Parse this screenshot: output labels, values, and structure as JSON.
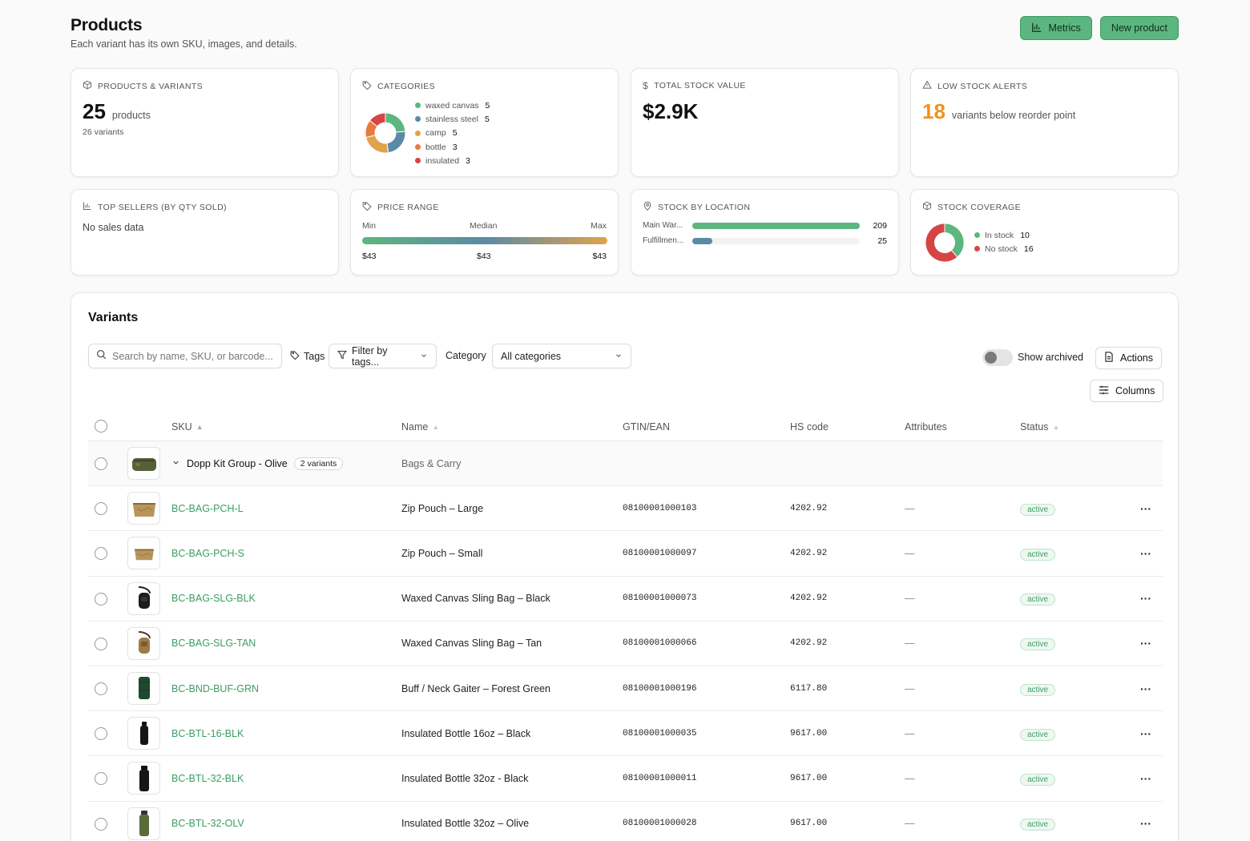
{
  "header": {
    "title": "Products",
    "subtitle": "Each variant has its own SKU, images, and details.",
    "metrics_label": "Metrics",
    "new_product_label": "New product"
  },
  "cards": {
    "products_variants": {
      "title": "PRODUCTS & VARIANTS",
      "count": "25",
      "count_unit": "products",
      "variants_text": "26 variants"
    },
    "categories": {
      "title": "CATEGORIES",
      "items": [
        {
          "label": "waxed canvas",
          "count": "5",
          "color": "#5cb67f"
        },
        {
          "label": "stainless steel",
          "count": "5",
          "color": "#5b8aa6"
        },
        {
          "label": "camp",
          "count": "5",
          "color": "#e0a24a"
        },
        {
          "label": "bottle",
          "count": "3",
          "color": "#e87a3c"
        },
        {
          "label": "insulated",
          "count": "3",
          "color": "#d64545"
        }
      ]
    },
    "total_stock_value": {
      "title": "TOTAL STOCK VALUE",
      "value": "$2.9K"
    },
    "low_stock": {
      "title": "LOW STOCK ALERTS",
      "value": "18",
      "text": "variants below reorder point",
      "color": "#f0921e"
    },
    "top_sellers": {
      "title": "TOP SELLERS (BY QTY SOLD)",
      "text": "No sales data"
    },
    "price_range": {
      "title": "PRICE RANGE",
      "min_label": "Min",
      "median_label": "Median",
      "max_label": "Max",
      "min": "$43",
      "median": "$43",
      "max": "$43"
    },
    "stock_by_location": {
      "title": "STOCK BY LOCATION",
      "locations": [
        {
          "label": "Main War...",
          "value": "209",
          "fraction": 1.0,
          "color": "#5cb67f"
        },
        {
          "label": "Fulfillmen...",
          "value": "25",
          "fraction": 0.12,
          "color": "#5b8aa6"
        }
      ]
    },
    "stock_coverage": {
      "title": "STOCK COVERAGE",
      "items": [
        {
          "label": "In stock",
          "count": "10",
          "color": "#5cb67f"
        },
        {
          "label": "No stock",
          "count": "16",
          "color": "#d64545"
        }
      ]
    }
  },
  "variants": {
    "title": "Variants",
    "search_placeholder": "Search by name, SKU, or barcode...",
    "tags_label": "Tags",
    "tags_filter": "Filter by tags...",
    "category_label": "Category",
    "category_value": "All categories",
    "show_archived": "Show archived",
    "actions_label": "Actions",
    "columns_label": "Columns",
    "headers": {
      "sku": "SKU",
      "name": "Name",
      "gtin": "GTIN/EAN",
      "hs": "HS code",
      "attributes": "Attributes",
      "status": "Status"
    },
    "group": {
      "name": "Dopp Kit Group - Olive",
      "variants_badge": "2 variants",
      "category": "Bags & Carry"
    },
    "rows": [
      {
        "sku": "BC-BAG-PCH-L",
        "name": "Zip Pouch – Large",
        "gtin": "08100001000103",
        "hs": "4202.92",
        "attributes": "—",
        "status": "active"
      },
      {
        "sku": "BC-BAG-PCH-S",
        "name": "Zip Pouch – Small",
        "gtin": "08100001000097",
        "hs": "4202.92",
        "attributes": "—",
        "status": "active"
      },
      {
        "sku": "BC-BAG-SLG-BLK",
        "name": "Waxed Canvas Sling Bag – Black",
        "gtin": "08100001000073",
        "hs": "4202.92",
        "attributes": "—",
        "status": "active"
      },
      {
        "sku": "BC-BAG-SLG-TAN",
        "name": "Waxed Canvas Sling Bag – Tan",
        "gtin": "08100001000066",
        "hs": "4202.92",
        "attributes": "—",
        "status": "active"
      },
      {
        "sku": "BC-BND-BUF-GRN",
        "name": "Buff / Neck Gaiter – Forest Green",
        "gtin": "08100001000196",
        "hs": "6117.80",
        "attributes": "—",
        "status": "active"
      },
      {
        "sku": "BC-BTL-16-BLK",
        "name": "Insulated Bottle 16oz – Black",
        "gtin": "08100001000035",
        "hs": "9617.00",
        "attributes": "—",
        "status": "active"
      },
      {
        "sku": "BC-BTL-32-BLK",
        "name": "Insulated Bottle 32oz - Black",
        "gtin": "08100001000011",
        "hs": "9617.00",
        "attributes": "—",
        "status": "active"
      },
      {
        "sku": "BC-BTL-32-OLV",
        "name": "Insulated Bottle 32oz – Olive",
        "gtin": "08100001000028",
        "hs": "9617.00",
        "attributes": "—",
        "status": "active"
      }
    ]
  }
}
